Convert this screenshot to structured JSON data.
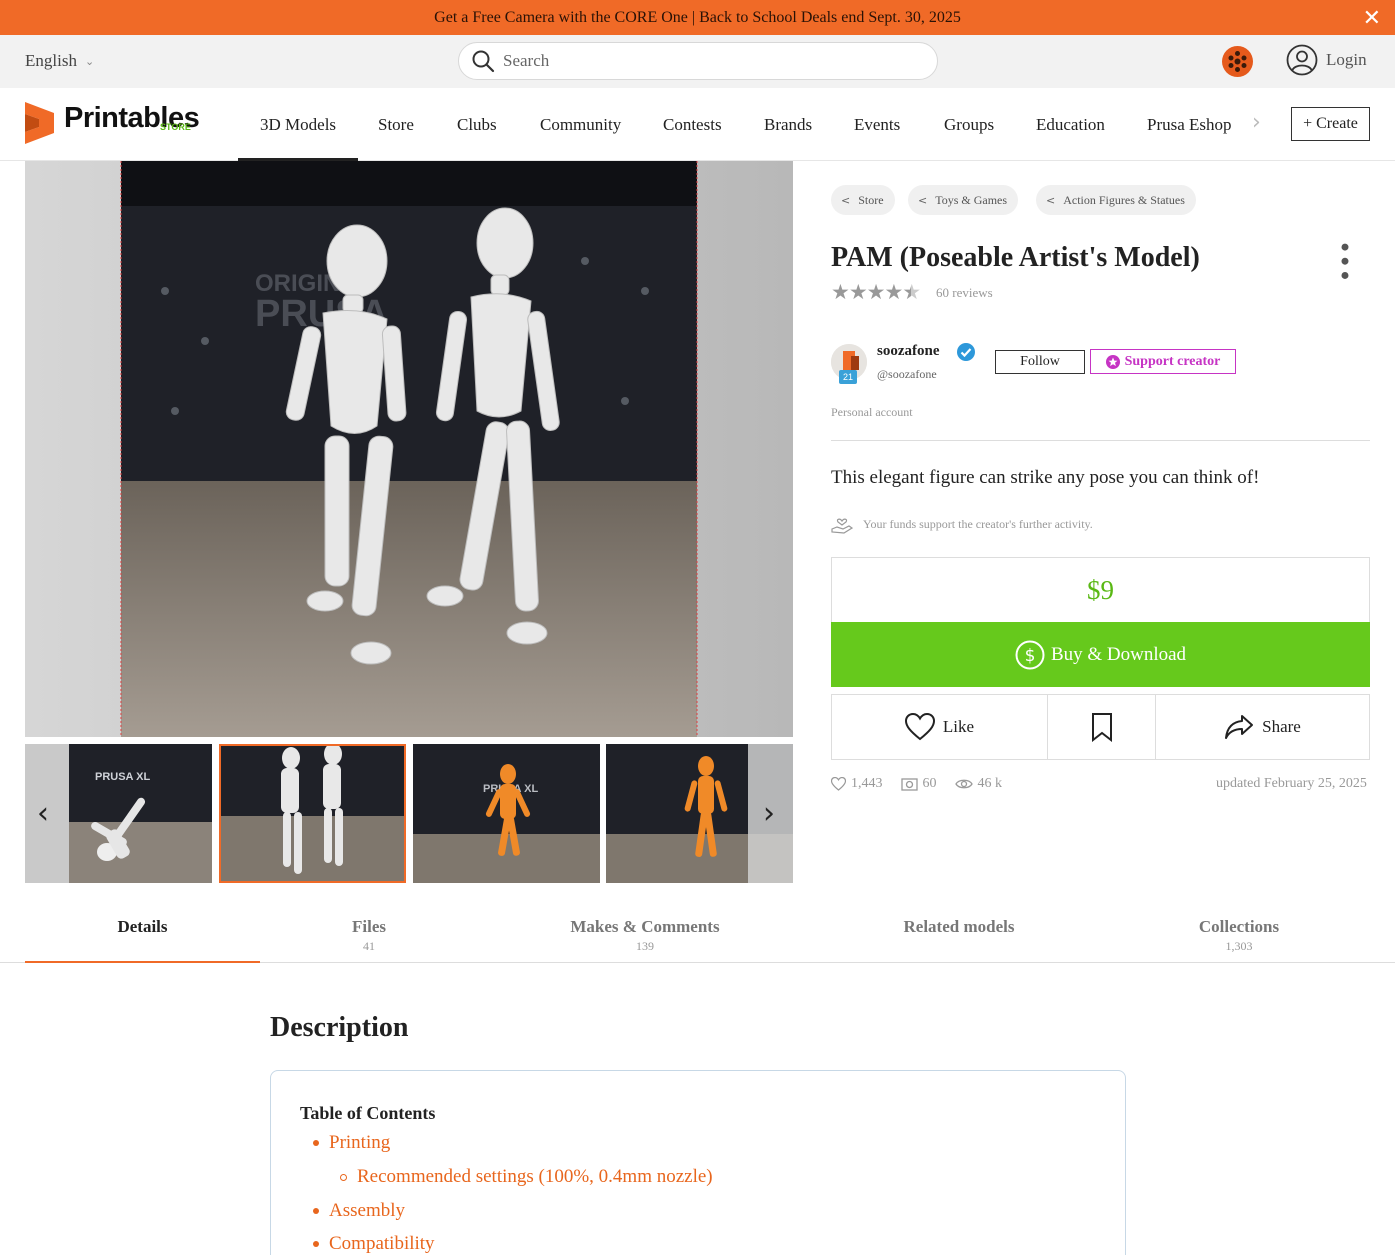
{
  "promo": {
    "text": "Get a Free Camera with the CORE One | Back to School Deals end Sept. 30, 2025",
    "close": "✕"
  },
  "topbar": {
    "language": "English",
    "search_placeholder": "Search",
    "login": "Login"
  },
  "brand": {
    "name": "Printables",
    "sub": "STORE",
    "accent": "#f06a27",
    "green": "#66c91c"
  },
  "nav": {
    "items": [
      "3D Models",
      "Store",
      "Clubs",
      "Community",
      "Contests",
      "Brands",
      "Events",
      "Groups",
      "Education",
      "Prusa Eshop"
    ],
    "create": "+ Create"
  },
  "breadcrumbs": [
    "Store",
    "Toys & Games",
    "Action Figures & Statues"
  ],
  "product": {
    "title": "PAM (Poseable Artist's Model)",
    "rating": 4.5,
    "reviews": "60 reviews",
    "summary": "This elegant figure can strike any pose you can think of!",
    "funds_note": "Your funds support the creator's further activity.",
    "price": "$9",
    "buy": "Buy & Download",
    "like": "Like",
    "share": "Share"
  },
  "author": {
    "name": "soozafone",
    "handle": "@soozafone",
    "level": "21",
    "account_type": "Personal account",
    "follow": "Follow",
    "support": "Support creator"
  },
  "stats": {
    "likes": "1,443",
    "makes": "60",
    "views": "46 k",
    "updated": "updated February 25, 2025"
  },
  "tabs": [
    {
      "label": "Details",
      "count": ""
    },
    {
      "label": "Files",
      "count": "41"
    },
    {
      "label": "Makes & Comments",
      "count": "139"
    },
    {
      "label": "Related models",
      "count": ""
    },
    {
      "label": "Collections",
      "count": "1,303"
    }
  ],
  "description": {
    "heading": "Description",
    "toc_title": "Table of Contents",
    "toc": [
      {
        "text": "Printing",
        "level": 1
      },
      {
        "text": "Recommended settings (100%, 0.4mm nozzle)",
        "level": 2
      },
      {
        "text": "Assembly",
        "level": 1
      },
      {
        "text": "Compatibility",
        "level": 1
      }
    ]
  }
}
